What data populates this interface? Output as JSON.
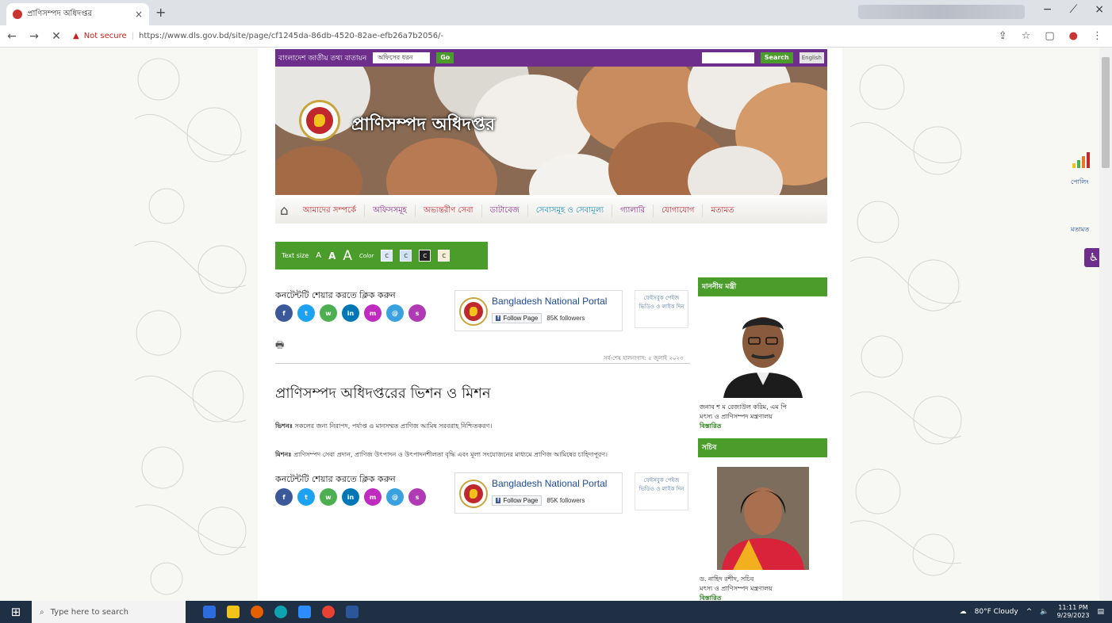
{
  "browser": {
    "tab_title": "প্রাণিসম্পদ অধিদপ্তর",
    "tab_close": "×",
    "new_tab": "+",
    "not_secure": "Not secure",
    "url": "https://www.dls.gov.bd/site/page/cf1245da-86db-4520-82ae-efb26a7b2056/-",
    "window_controls": [
      "−",
      "⟋",
      "×"
    ]
  },
  "site": {
    "topstrip": {
      "portal_label": "বাংলাদেশ জাতীয় তথ্য বাতায়ন",
      "office_select": "অফিসের ধরন",
      "go": "Go",
      "search": "Search",
      "english": "English"
    },
    "banner_title": "প্রাণিসম্পদ অধিদপ্তর",
    "nav": [
      "আমাদের সম্পর্কে",
      "অফিসসমূহ",
      "অভ্যন্তরীণ সেবা",
      "ডাটাবেজ",
      "সেবাসমূহ ও সেবামূল্য",
      "গ্যালারি",
      "যোগাযোগ",
      "মতামত"
    ],
    "access": {
      "text_size": "Text size",
      "sizes": [
        "A",
        "A",
        "A"
      ],
      "color": "Color",
      "swatches": [
        "C",
        "C",
        "C",
        "C"
      ]
    },
    "share_title": "কনটেন্টটি শেয়ার করতে ক্লিক করুন",
    "social_icons": [
      "f",
      "t",
      "w",
      "in",
      "m",
      "@",
      "s"
    ],
    "fb": {
      "name": "Bangladesh National Portal",
      "follow": "Follow Page",
      "followers": "85K followers"
    },
    "fb_text": "ফেইসবুক পেইজ ভিডিও ও লাইক দিন",
    "updated": "সর্ব-শেষ হালনাগাদ: ৫ জুলাই ২০২৩",
    "page_title": "প্রাণিসম্পদ অধিদপ্তরের ভিশন ও মিশন",
    "vision_label": "ভিশনঃ",
    "vision_text": "সকলের জন্য নিরাপদ, পর্যাপ্ত ও মানসম্মত প্রাণিজ আমিষ সরবরাহ নিশ্চিতকরণ।",
    "mission_label": "মিশনঃ",
    "mission_text": "প্রাণিসম্পদ সেবা প্রদান, প্রাণিজ উৎপাদন ও উৎপাদনশীলতা বৃদ্ধি এবং মূল্য সংযোজনের মাধ্যমে প্রাণিজ আমিষের চাহিদাপূরণ।",
    "sidebar": {
      "minister_head": "মাননীয় মন্ত্রী",
      "minister_name": "জনাব শ ম রেজাউল করিম, এম পি",
      "minister_ministry": "মৎস্য ও প্রাণিসম্পদ মন্ত্রণালয়",
      "more": "বিস্তারিত",
      "secretary_head": "সচিব",
      "secretary_name": "ড. নাহিদ রশীদ, সচিব",
      "secretary_ministry": "মৎস্য ও প্রাণিসম্পদ মন্ত্রণালয়",
      "secretary_more": "বিস্তারিত"
    },
    "right_widgets": {
      "poll": "পোলিং",
      "opinion": "মতামত"
    }
  },
  "taskbar": {
    "search_placeholder": "Type here to search",
    "weather": "80°F Cloudy",
    "time": "11:11 PM",
    "date": "9/29/2023"
  }
}
